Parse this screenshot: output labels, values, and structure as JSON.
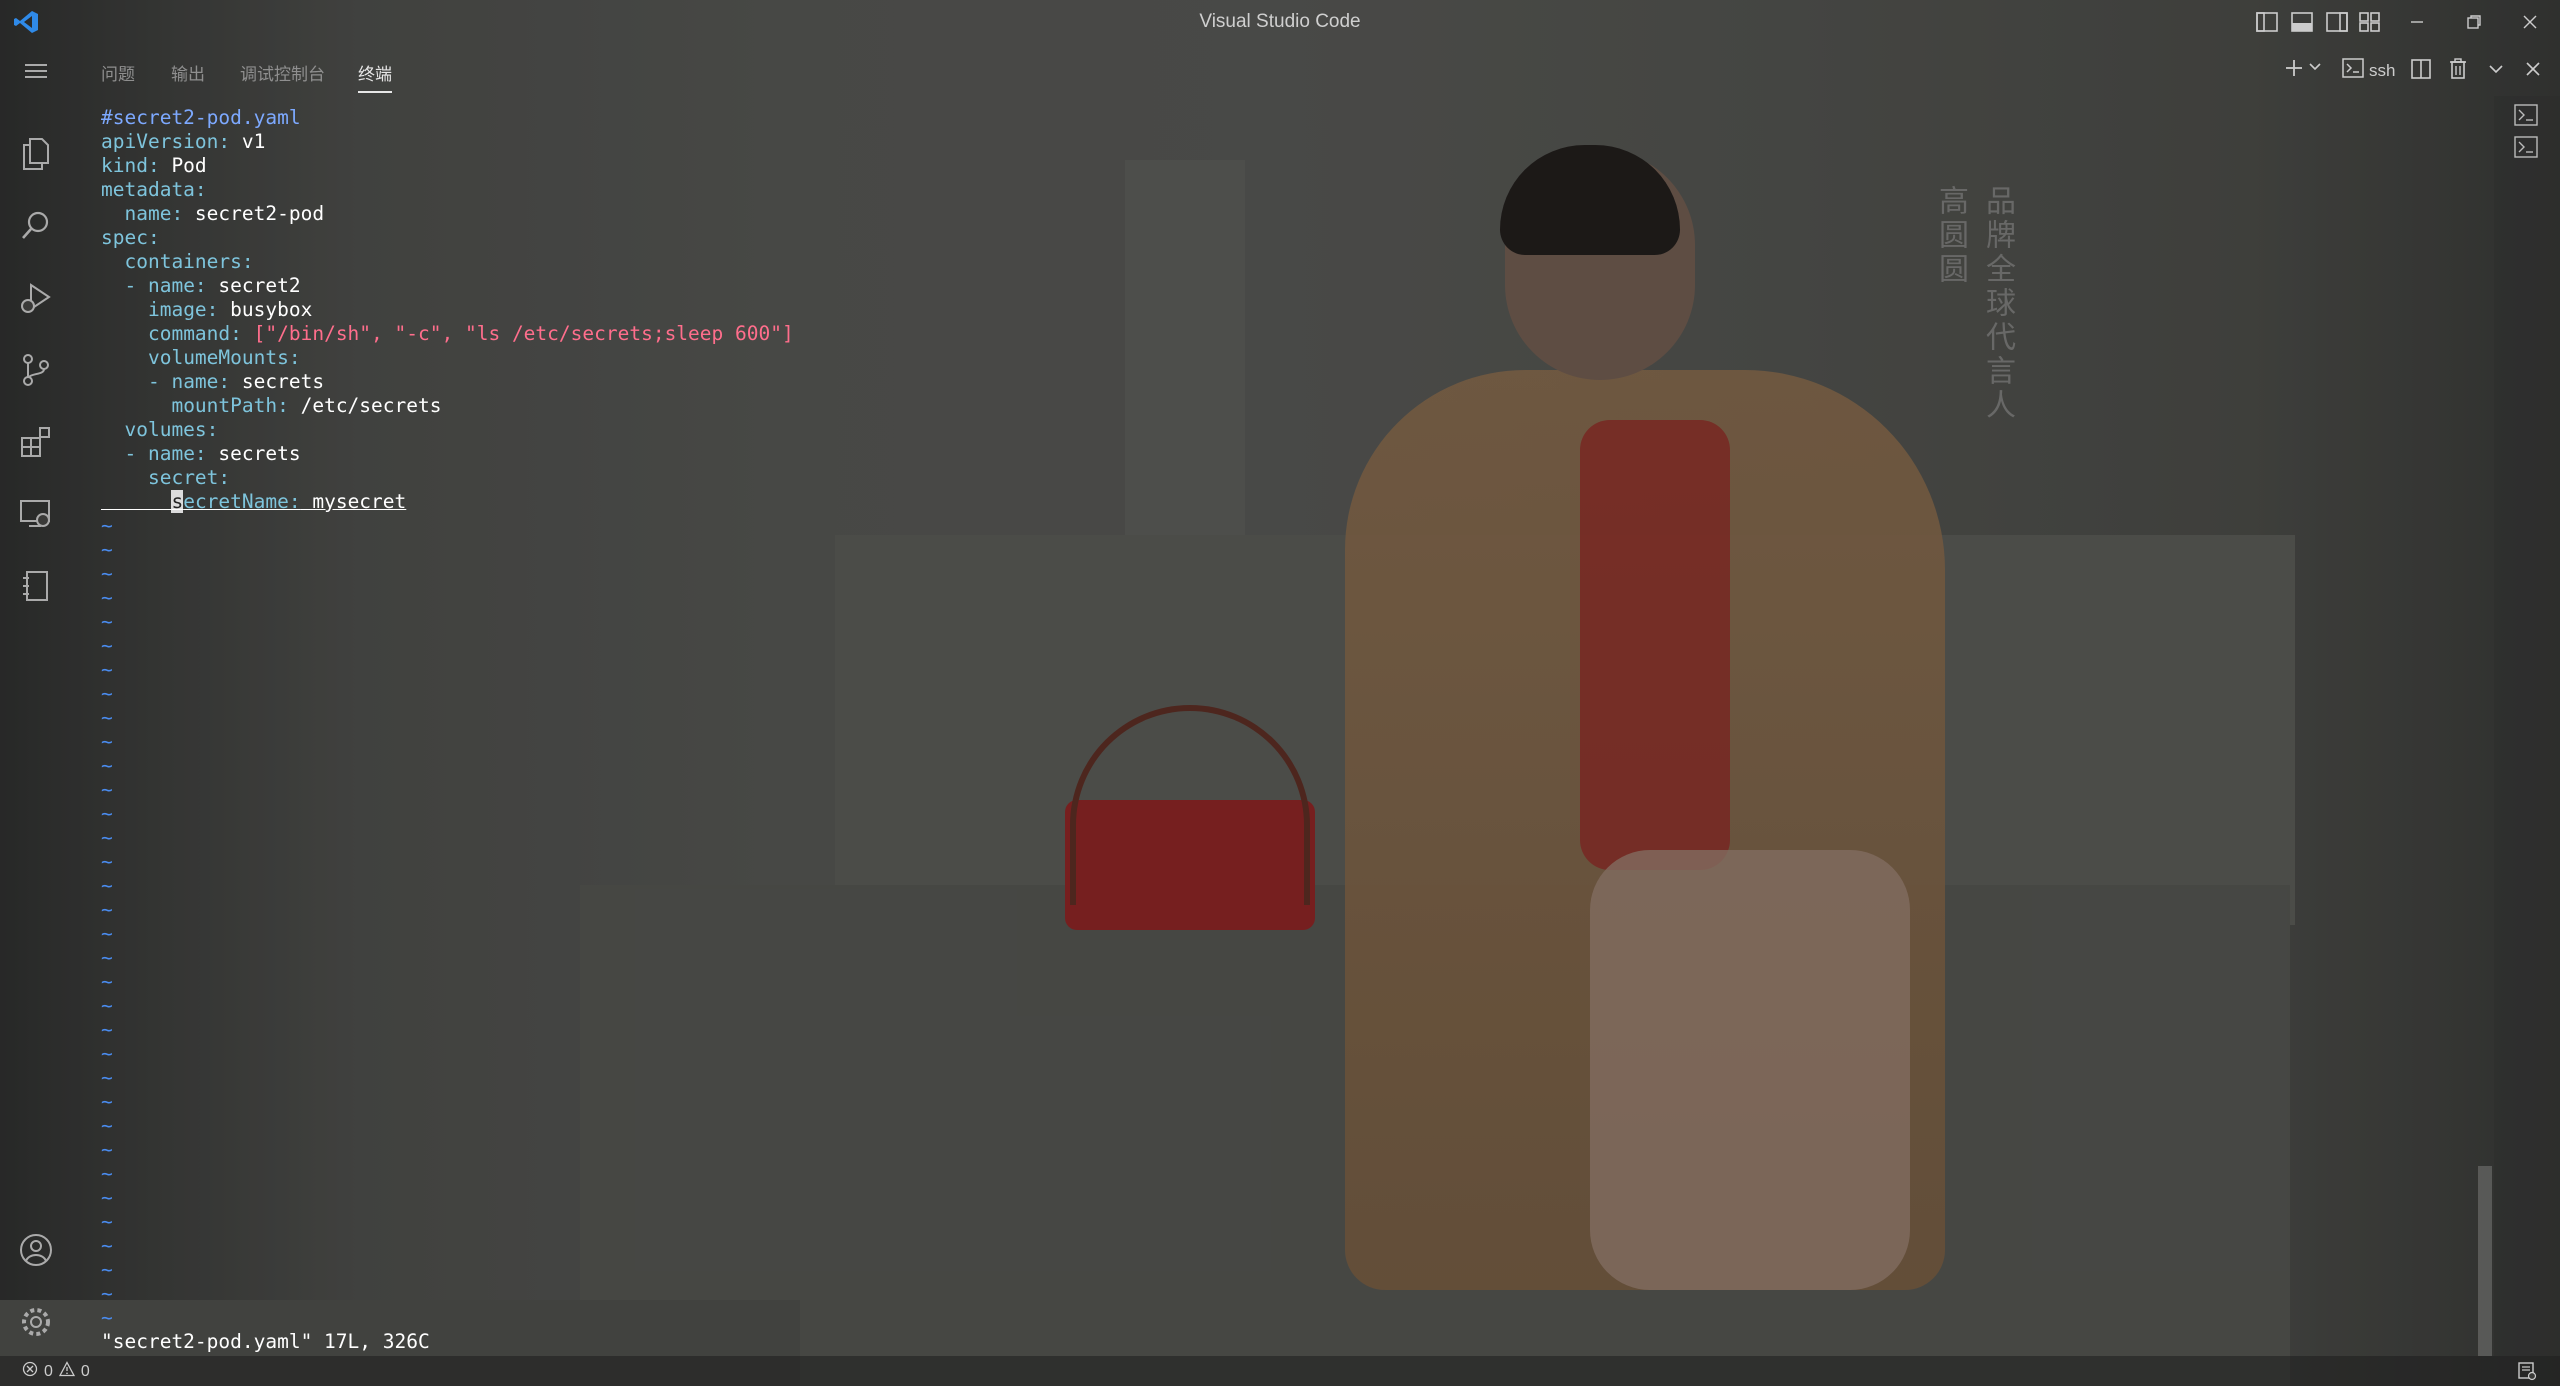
{
  "window": {
    "title": "Visual Studio Code"
  },
  "panel": {
    "tabs": [
      {
        "label": "问题"
      },
      {
        "label": "输出"
      },
      {
        "label": "调试控制台"
      },
      {
        "label": "终端"
      }
    ],
    "active_tab": "终端",
    "terminal_profile": "ssh"
  },
  "terminal": {
    "lines": [
      "#secret2-pod.yaml",
      "apiVersion: v1",
      "kind: Pod",
      "metadata:",
      "  name: secret2-pod",
      "spec:",
      "  containers:",
      "  - name: secret2",
      "    image: busybox",
      "    command: [\"/bin/sh\", \"-c\", \"ls /etc/secrets;sleep 600\"]",
      "    volumeMounts:",
      "    - name: secrets",
      "      mountPath: /etc/secrets",
      "  volumes:",
      "  - name: secrets",
      "    secret:",
      "      secretName: mysecret"
    ],
    "empty_line_marker": "~",
    "empty_line_count": 34,
    "status_message": "\"secret2-pod.yaml\" 17L, 326C"
  },
  "statusbar": {
    "errors": "0",
    "warnings": "0"
  },
  "wallpaper": {
    "vertical_text_1": "品牌全球代言人",
    "vertical_text_2": "高圆圆"
  },
  "colors": {
    "yaml_key": "#7ec4dc",
    "yaml_comment": "#7da9ff",
    "yaml_string": "#ff6e8c",
    "vim_tilde": "#4a8cf0",
    "vscode_blue": "#2f8ae8"
  }
}
